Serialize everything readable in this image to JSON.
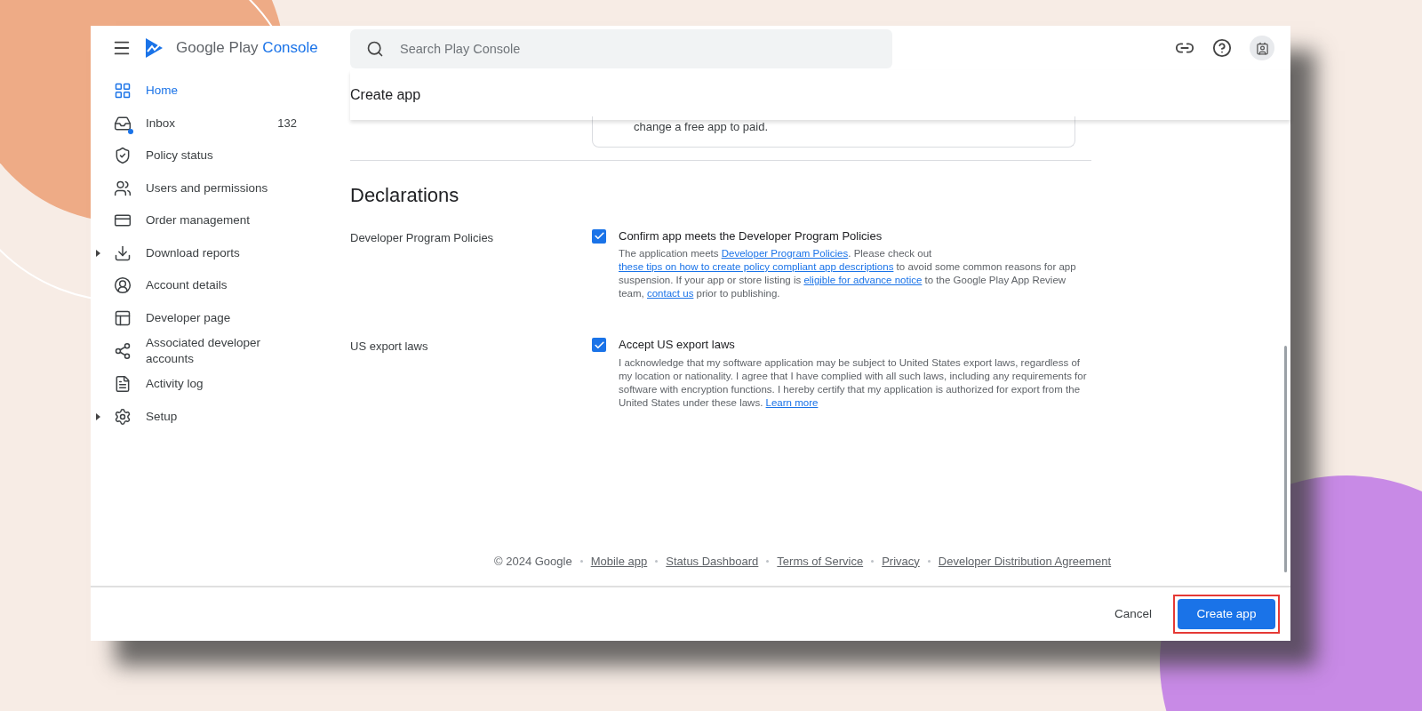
{
  "app_bar": {
    "product_name": "Google Play",
    "product_suffix": "Console",
    "search": {
      "placeholder": "Search Play Console"
    }
  },
  "sidebar": {
    "items": [
      {
        "label": "Home",
        "selected": true,
        "expandable": false
      },
      {
        "label": "Inbox",
        "selected": false,
        "expandable": false,
        "count": "132"
      },
      {
        "label": "Policy status",
        "selected": false,
        "expandable": false
      },
      {
        "label": "Users and permissions",
        "selected": false,
        "expandable": false
      },
      {
        "label": "Order management",
        "selected": false,
        "expandable": false
      },
      {
        "label": "Download reports",
        "selected": false,
        "expandable": true
      },
      {
        "label": "Account details",
        "selected": false,
        "expandable": false
      },
      {
        "label": "Developer page",
        "selected": false,
        "expandable": false
      },
      {
        "label": "Associated developer accounts",
        "selected": false,
        "expandable": false
      },
      {
        "label": "Activity log",
        "selected": false,
        "expandable": false
      },
      {
        "label": "Setup",
        "selected": false,
        "expandable": true
      }
    ]
  },
  "page_title": "Create app",
  "info_box": {
    "text": "change a free app to paid."
  },
  "declarations": {
    "heading": "Declarations",
    "rows": [
      {
        "label": "Developer Program Policies",
        "checked": true,
        "title": "Confirm app meets the Developer Program Policies",
        "description": [
          {
            "text": "The application meets ",
            "link": false
          },
          {
            "text": "Developer Program Policies",
            "link": true
          },
          {
            "text": ". Please check out ",
            "link": false
          },
          {
            "text": "these tips on how to create policy compliant app descriptions",
            "link": true
          },
          {
            "text": " to avoid some common reasons for app suspension. If your app or store listing is ",
            "link": false
          },
          {
            "text": "eligible for advance notice",
            "link": true
          },
          {
            "text": " to the Google Play App Review team, ",
            "link": false
          },
          {
            "text": "contact us",
            "link": true
          },
          {
            "text": " prior to publishing.",
            "link": false
          }
        ]
      },
      {
        "label": "US export laws",
        "checked": true,
        "title": "Accept US export laws",
        "description": [
          {
            "text": "I acknowledge that my software application may be subject to United States export laws, regardless of my location or nationality. I agree that I have complied with all such laws, including any requirements for software with encryption functions. I hereby certify that my application is authorized for export from the United States under these laws. ",
            "link": false
          },
          {
            "text": "Learn more",
            "link": true
          }
        ]
      }
    ]
  },
  "footer": {
    "copyright": "© 2024 Google",
    "links": [
      "Mobile app",
      "Status Dashboard",
      "Terms of Service",
      "Privacy",
      "Developer Distribution Agreement"
    ]
  },
  "actions": {
    "cancel": "Cancel",
    "primary": "Create app",
    "primary_highlighted": true
  }
}
